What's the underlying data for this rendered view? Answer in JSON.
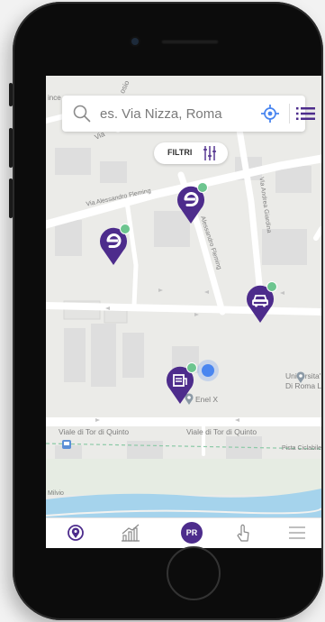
{
  "search": {
    "placeholder": "es. Via Nizza, Roma"
  },
  "filters": {
    "label": "FILTRI"
  },
  "map": {
    "streets": [
      "Via Alessandro Fleming",
      "Via Andrea Giardina",
      "Alessandro Fleming",
      "Viale di Tor di Quinto",
      "Viale di Tor di Quinto",
      "Pista Ciclabile",
      "Milvio",
      "ince",
      "osio",
      "Via"
    ],
    "poi": {
      "enel": "Enel X",
      "university_line1": "Universita'",
      "university_line2": "Di Roma La"
    }
  },
  "tabbar": {
    "profile_label": "PR"
  },
  "colors": {
    "brand_purple": "#4d2c8c",
    "status_green": "#6dc58f",
    "accent_blue": "#4a86f0"
  },
  "icons": [
    "search-icon",
    "locate-icon",
    "list-icon",
    "filter-sliders-icon",
    "charging-pin-icon",
    "car-pin-icon",
    "station-pin-icon",
    "map-tab-icon",
    "stats-tab-icon",
    "touch-tab-icon",
    "menu-tab-icon"
  ]
}
